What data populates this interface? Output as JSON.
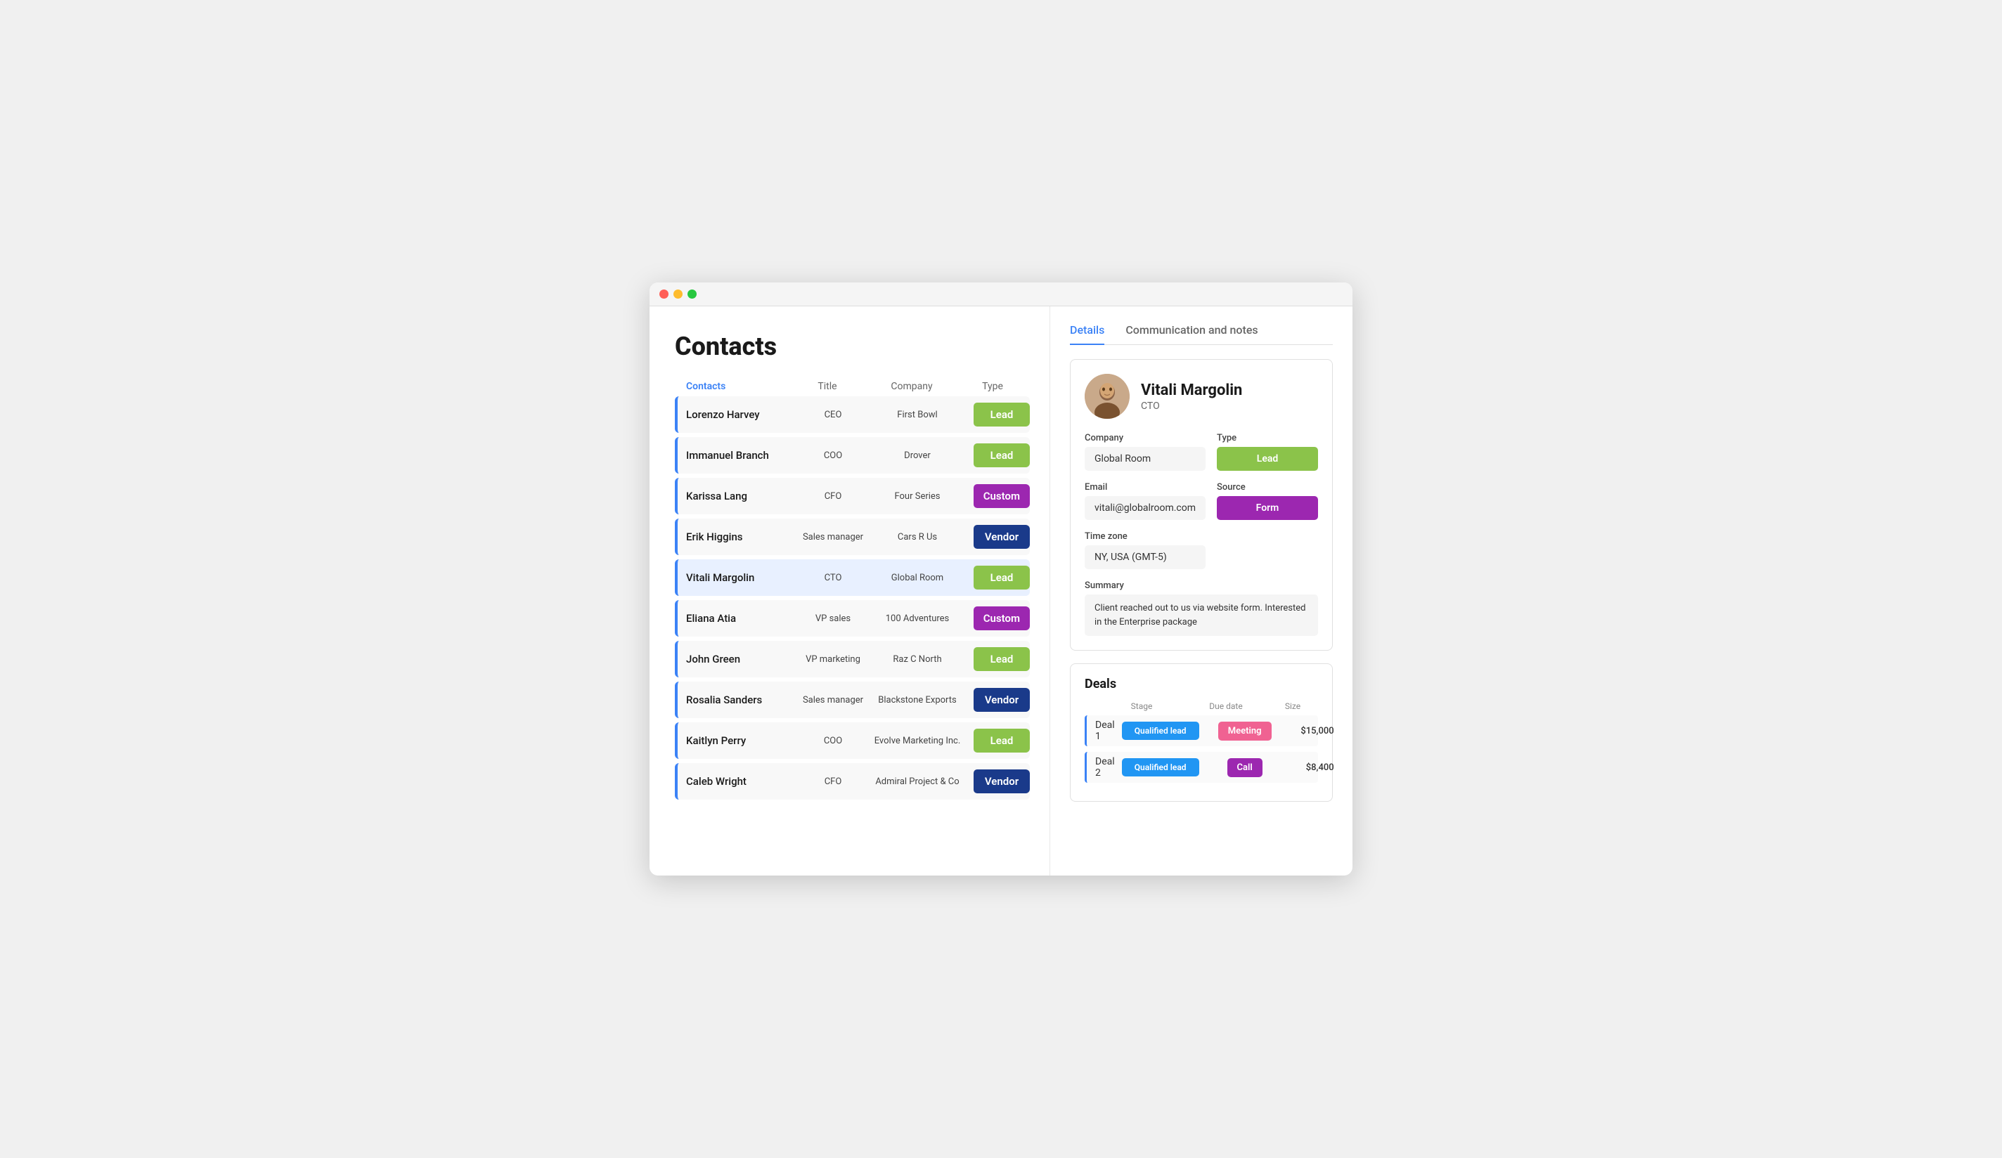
{
  "window": {
    "title": "Contacts"
  },
  "page": {
    "title": "Contacts"
  },
  "table": {
    "headers": {
      "contacts": "Contacts",
      "title": "Title",
      "company": "Company",
      "type": "Type"
    },
    "rows": [
      {
        "name": "Lorenzo Harvey",
        "title": "CEO",
        "company": "First Bowl",
        "type": "Lead",
        "badge": "lead"
      },
      {
        "name": "Immanuel Branch",
        "title": "COO",
        "company": "Drover",
        "type": "Lead",
        "badge": "lead"
      },
      {
        "name": "Karissa Lang",
        "title": "CFO",
        "company": "Four Series",
        "type": "Custom",
        "badge": "custom"
      },
      {
        "name": "Erik Higgins",
        "title": "Sales manager",
        "company": "Cars R Us",
        "type": "Vendor",
        "badge": "vendor"
      },
      {
        "name": "Vitali Margolin",
        "title": "CTO",
        "company": "Global Room",
        "type": "Lead",
        "badge": "lead",
        "active": true
      },
      {
        "name": "Eliana Atia",
        "title": "VP sales",
        "company": "100 Adventures",
        "type": "Custom",
        "badge": "custom"
      },
      {
        "name": "John Green",
        "title": "VP marketing",
        "company": "Raz C North",
        "type": "Lead",
        "badge": "lead"
      },
      {
        "name": "Rosalia Sanders",
        "title": "Sales manager",
        "company": "Blackstone Exports",
        "type": "Vendor",
        "badge": "vendor"
      },
      {
        "name": "Kaitlyn Perry",
        "title": "COO",
        "company": "Evolve Marketing Inc.",
        "type": "Lead",
        "badge": "lead"
      },
      {
        "name": "Caleb Wright",
        "title": "CFO",
        "company": "Admiral Project & Co",
        "type": "Vendor",
        "badge": "vendor"
      }
    ]
  },
  "tabs": {
    "details": "Details",
    "communication": "Communication and notes"
  },
  "detail": {
    "name": "Vitali Margolin",
    "role": "CTO",
    "company_label": "Company",
    "company_value": "Global Room",
    "type_label": "Type",
    "type_value": "Lead",
    "email_label": "Email",
    "email_value": "vitali@globalroom.com",
    "source_label": "Source",
    "source_value": "Form",
    "timezone_label": "Time zone",
    "timezone_value": "NY, USA (GMT-5)",
    "summary_label": "Summary",
    "summary_value": "Client reached out to us via website form. Interested in the Enterprise package"
  },
  "deals": {
    "title": "Deals",
    "headers": {
      "stage": "Stage",
      "due_date": "Due date",
      "size": "Size"
    },
    "rows": [
      {
        "name": "Deal 1",
        "stage": "Qualified lead",
        "due": "Meeting",
        "due_type": "meeting",
        "size": "$15,000"
      },
      {
        "name": "Deal 2",
        "stage": "Qualified lead",
        "due": "Call",
        "due_type": "call",
        "size": "$8,400"
      }
    ]
  }
}
